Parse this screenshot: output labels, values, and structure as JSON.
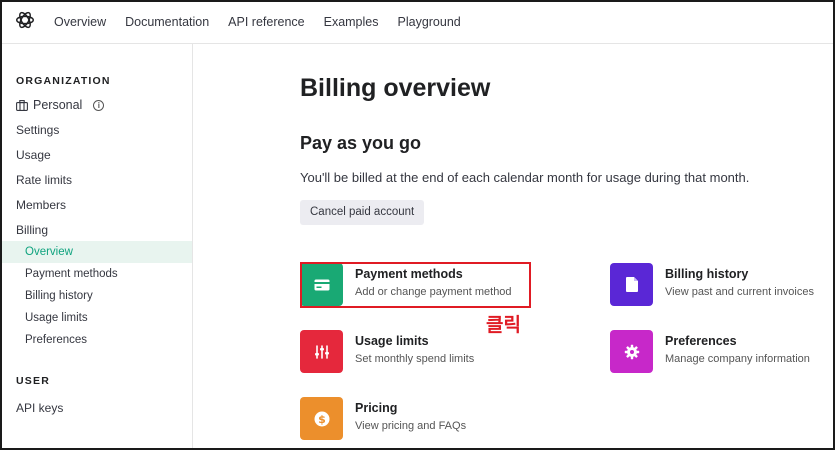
{
  "topnav": {
    "links": [
      "Overview",
      "Documentation",
      "API reference",
      "Examples",
      "Playground"
    ]
  },
  "sidebar": {
    "org_heading": "ORGANIZATION",
    "org_name": "Personal",
    "items": [
      "Settings",
      "Usage",
      "Rate limits",
      "Members",
      "Billing"
    ],
    "billing_sub": [
      "Overview",
      "Payment methods",
      "Billing history",
      "Usage limits",
      "Preferences"
    ],
    "active_sub": "Overview",
    "user_heading": "USER",
    "user_items": [
      "API keys"
    ]
  },
  "main": {
    "title": "Billing overview",
    "section_title": "Pay as you go",
    "description": "You'll be billed at the end of each calendar month for usage during that month.",
    "cancel_button": "Cancel paid account",
    "cards": [
      {
        "title": "Payment methods",
        "subtitle": "Add or change payment method",
        "color": "#19a974",
        "icon": "credit-card-icon"
      },
      {
        "title": "Billing history",
        "subtitle": "View past and current invoices",
        "color": "#5a27d6",
        "icon": "document-icon"
      },
      {
        "title": "Usage limits",
        "subtitle": "Set monthly spend limits",
        "color": "#e5283c",
        "icon": "sliders-icon"
      },
      {
        "title": "Preferences",
        "subtitle": "Manage company information",
        "color": "#c728c9",
        "icon": "gear-icon"
      },
      {
        "title": "Pricing",
        "subtitle": "View pricing and FAQs",
        "color": "#ec8f2c",
        "icon": "dollar-icon"
      }
    ]
  },
  "annotation": {
    "click_label": "클릭",
    "highlight_color": "#e01b24"
  }
}
